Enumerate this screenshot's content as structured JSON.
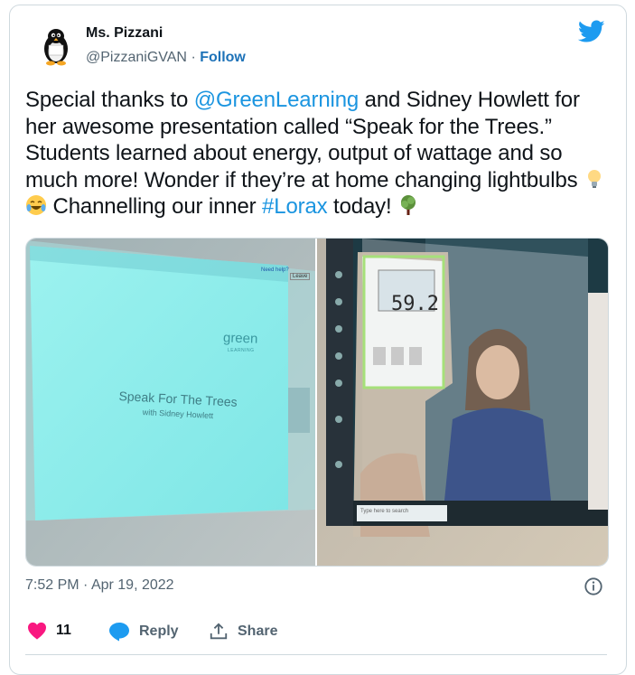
{
  "author": {
    "name": "Ms. Pizzani",
    "handle": "@PizzaniGVAN",
    "separator": "·",
    "follow_label": "Follow",
    "avatar_icon": "penguin-avatar-icon",
    "avatar_text": "I love penguins"
  },
  "tweet": {
    "t1": "Special thanks to ",
    "m1": "@GreenLearning",
    "t2": " and Sidney Howlett for her awesome presentation called “Speak for the Trees.” Students learned about energy, output of wattage and so much more!  Wonder if they’re at home changing lightbulbs ",
    "t3": " Channelling our inner ",
    "hashtag": "#Lorax",
    "t4": " today! "
  },
  "photos": {
    "left": {
      "logo_top": "green",
      "logo_bottom": "LEARNING",
      "slide_title": "Speak For The Trees",
      "slide_subtitle": "with Sidney Howlett",
      "need_help": "Need help?",
      "leave": "Leave"
    },
    "right": {
      "meter_value": "59.2",
      "taskbar_search": "Type here to search"
    }
  },
  "meta": {
    "time": "7:52 PM",
    "sep": "·",
    "date": "Apr 19, 2022"
  },
  "actions": {
    "likes_count": "11",
    "reply_label": "Reply",
    "share_label": "Share"
  },
  "colors": {
    "link": "#1b95e0",
    "like": "#f91880",
    "reply": "#1d9bf0",
    "twitter": "#1d9bf0"
  }
}
